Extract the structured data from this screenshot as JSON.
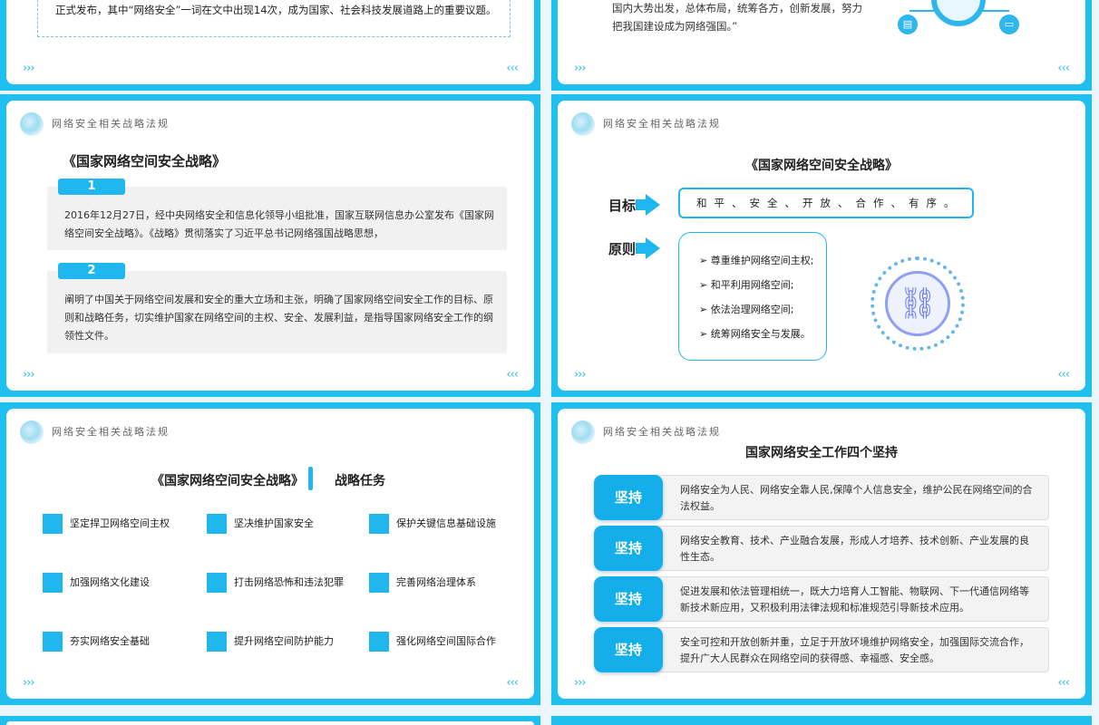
{
  "header_title": "网络安全相关战略法规",
  "nav": {
    "prev": "›››",
    "next": "‹‹‹"
  },
  "slide1": {
    "text": "正式发布，其中“网络安全”一词在文中出现14次，成为国家、社会科技发展道路上的重要议题。"
  },
  "slide2": {
    "quote_line1": "国内大势出发，总体布局，统筹各方，创新发展，努力",
    "quote_line2": "把我国建设成为网络强国。”"
  },
  "slide3": {
    "title": "《国家网络空间安全战略》",
    "items": [
      {
        "num": "1",
        "text": "2016年12月27日，经中央网络安全和信息化领导小组批准，国家互联网信息办公室发布《国家网络空间安全战略》。《战略》贯彻落实了习近平总书记网络强国战略思想，"
      },
      {
        "num": "2",
        "text": "阐明了中国关于网络空间发展和安全的重大立场和主张，明确了国家网络空间安全工作的目标、原则和战略任务，切实维护国家在网络空间的主权、安全、发展利益，是指导国家网络安全工作的纲领性文件。"
      }
    ]
  },
  "slide4": {
    "title": "《国家网络空间安全战略》",
    "goal_label": "目标",
    "goal_text": "和平、安全、开放、合作、有序。",
    "principle_label": "原则",
    "principles": [
      "尊重维护网络空间主权;",
      "和平利用网络空间;",
      "依法治理网络空间;",
      "统筹网络安全与发展。"
    ]
  },
  "slide5": {
    "title_left": "《国家网络空间安全战略》",
    "title_right": "战略任务",
    "tasks": [
      "坚定捍卫网络空间主权",
      "坚决维护国家安全",
      "保护关键信息基础设施",
      "加强网络文化建设",
      "打击网络恐怖和违法犯罪",
      "完善网络治理体系",
      "夯实网络安全基础",
      "提升网络空间防护能力",
      "强化网络空间国际合作"
    ]
  },
  "slide6": {
    "title": "国家网络安全工作四个坚持",
    "items": [
      {
        "tag": "坚持",
        "text": "网络安全为人民、网络安全靠人民,保障个人信息安全，维护公民在网络空间的合法权益。"
      },
      {
        "tag": "坚持",
        "text": "网络安全教育、技术、产业融合发展，形成人才培养、技术创新、产业发展的良性生态。"
      },
      {
        "tag": "坚持",
        "text": "促进发展和依法管理相统一，既大力培育人工智能、物联网、下一代通信网络等新技术新应用，又积极利用法律法规和标准规范引导新技术应用。"
      },
      {
        "tag": "坚持",
        "text": "安全可控和开放创新并重，立足于开放环境维护网络安全，加强国际交流合作，提升广大人民群众在网络空间的获得感、幸福感、安全感。"
      }
    ]
  },
  "colors": {
    "accent": "#1fc0ef",
    "badge": "#1fb7ee",
    "card": "#ffffff"
  }
}
